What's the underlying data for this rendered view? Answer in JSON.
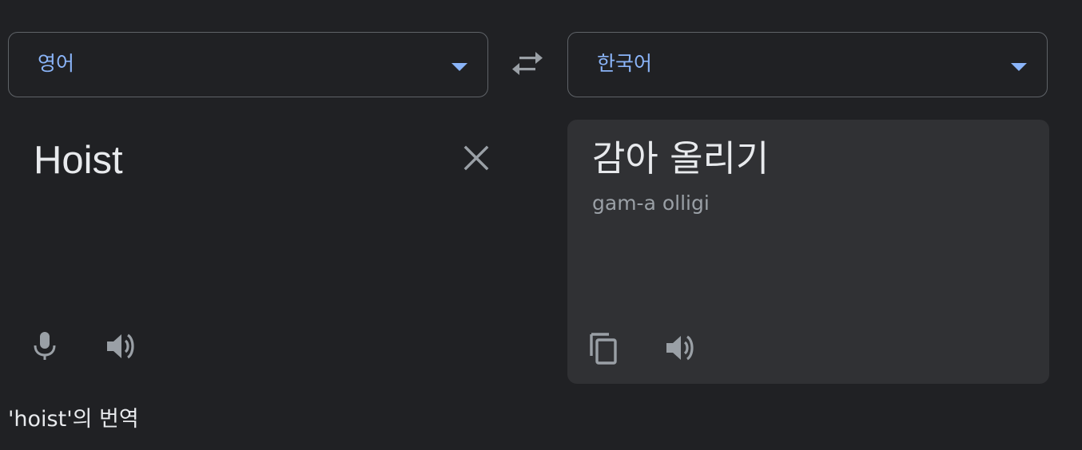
{
  "source_language": {
    "label": "영어"
  },
  "target_language": {
    "label": "한국어"
  },
  "source": {
    "text": "Hoist"
  },
  "target": {
    "text": "감아 올리기",
    "romanization": "gam-a olligi"
  },
  "caption": "'hoist'의 번역",
  "icons": {
    "swap": "swap-arrows-icon",
    "clear": "close-icon",
    "microphone": "microphone-icon",
    "speaker": "speaker-icon",
    "copy": "copy-icon",
    "dropdown": "chevron-down-icon"
  },
  "colors": {
    "background": "#202124",
    "panel": "#303134",
    "accent": "#8ab4f8",
    "text": "#e8eaed",
    "muted": "#9aa0a6",
    "border": "#5f6368"
  }
}
